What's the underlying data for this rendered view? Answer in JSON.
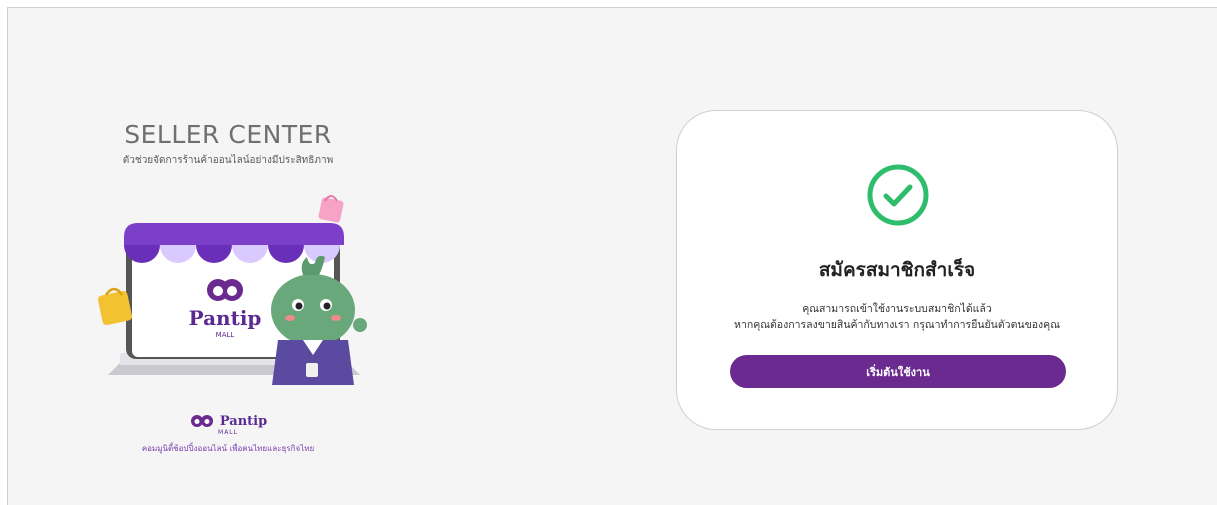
{
  "brand": {
    "title": "SELLER CENTER",
    "subtitle": "ตัวช่วยจัดการร้านค้าออนไลน์อย่างมีประสิทธิภาพ",
    "logo_name": "Pantip",
    "logo_mall": "MALL",
    "footer_name": "Pantip",
    "footer_mall": "MALL",
    "tagline": "คอมมูนิตี้ช้อปปิ้งออนไลน์ เพื่อคนไทยและธุรกิจไทย"
  },
  "card": {
    "icon": "check-circle-icon",
    "title": "สมัครสมาชิกสำเร็จ",
    "message_line1": "คุณสามารถเข้าใช้งานระบบสมาชิกได้แล้ว",
    "message_line2": "หากคุณต้องการลงขายสินค้ากับทางเรา กรุณาทำการยืนยันตัวตนของคุณ",
    "button_label": "เริ่มต้นใช้งาน"
  },
  "colors": {
    "accent": "#6b2a8f",
    "success": "#2ebd6b",
    "background": "#f5f5f5"
  }
}
